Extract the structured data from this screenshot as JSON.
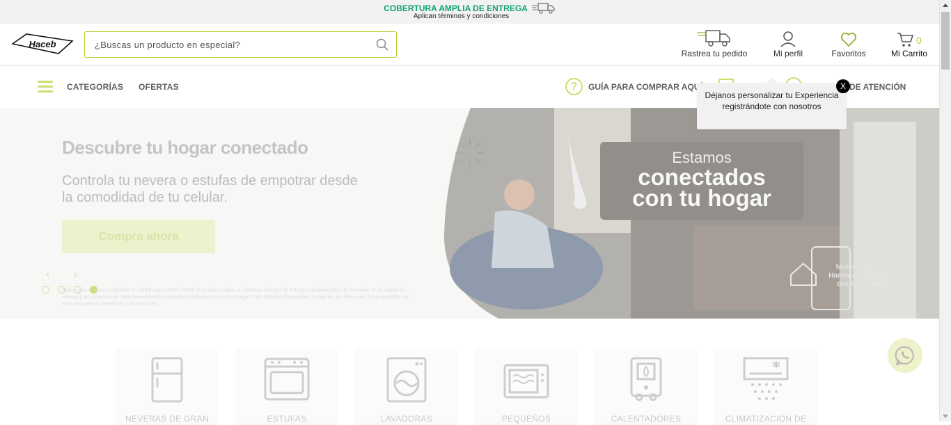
{
  "promo": {
    "headline": "COBERTURA AMPLIA DE ENTREGA",
    "subline": "Aplican términos y condiciones"
  },
  "header": {
    "logo_text": "Haceb",
    "search_placeholder": "¿Buscas un producto en especial?",
    "track_label": "Rastrea tu pedido",
    "profile_label": "Mi perfil",
    "favorites_label": "Favoritos",
    "cart_label": "Mi Carrito",
    "cart_count": "0"
  },
  "nav": {
    "categories_label": "CATEGORÍAS",
    "offers_label": "OFERTAS",
    "guide_label": "GUÍA PARA COMPRAR AQUÍ",
    "attention_label": "DE ATENCIÓN"
  },
  "tooltip": {
    "text": "Déjanos personalizar tu Experiencia registrándote con nosotros",
    "close_label": "X"
  },
  "hero": {
    "title": "Descubre tu hogar conectado",
    "subtitle": "Controla tu nevera o estufas de empotrar desde la comodidad de tu celular.",
    "cta_label": "Compra ahora",
    "prev_label": "‹",
    "next_label": "›",
    "banner_line1": "Estamos",
    "banner_line2": "conectados",
    "banner_line3": "con tu hogar",
    "side_note": "Nuevas Neveras Haceb conectadas desde tu celular",
    "fine_print": "Aplica para compras realizadas en haceb.com y #406 | Venta de producto sujeta a cobertura, tiempos de entrega y disponibilidad de inventario en la ciudad de entrega | Ver cobertura en https://www.haceb.com/institucional/cobertura-para-entregas | 50 Unidades Disponibles | Imágenes de referencia | No acumulable con otros descuentos, beneficios y promociones."
  },
  "categories": [
    {
      "name": "NEVERAS DE GRAN",
      "icon": "fridge-icon"
    },
    {
      "name": "ESTUFAS",
      "icon": "stove-icon"
    },
    {
      "name": "LAVADORAS",
      "icon": "washer-icon"
    },
    {
      "name": "PEQUEÑOS",
      "icon": "microwave-icon"
    },
    {
      "name": "CALENTADORES",
      "icon": "heater-icon"
    },
    {
      "name": "CLIMATIZACIÓN DE",
      "icon": "air-conditioner-icon"
    }
  ],
  "colors": {
    "brand_green": "#b7cf2e",
    "promo_green": "#12a46b"
  }
}
